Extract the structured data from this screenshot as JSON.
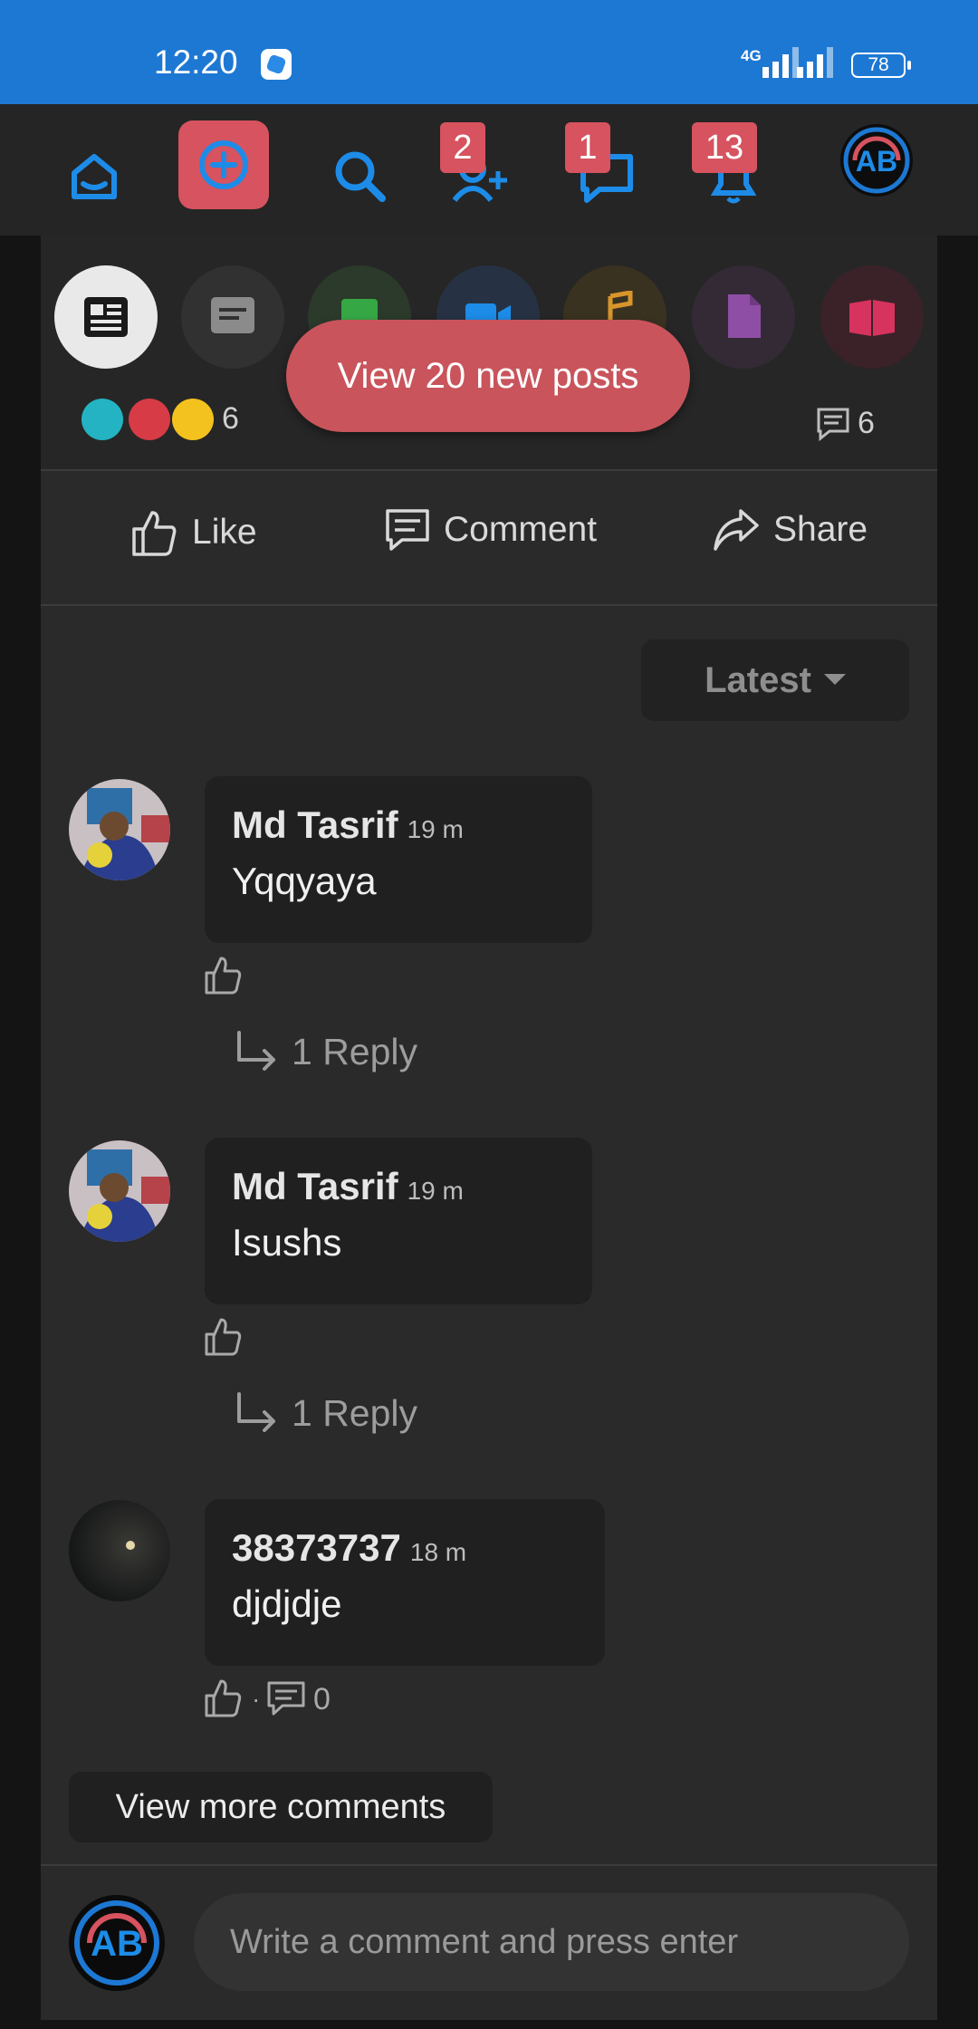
{
  "status": {
    "time": "12:20",
    "network": "4G",
    "battery": "78"
  },
  "nav": {
    "badge_friends": "2",
    "badge_messages": "1",
    "badge_notifications": "13"
  },
  "post": {
    "reaction_count": "6",
    "comment_count": "6",
    "actions": {
      "like": "Like",
      "comment": "Comment",
      "share": "Share"
    },
    "new_posts_label": "View 20 new posts"
  },
  "comments_section": {
    "sort_label": "Latest",
    "comments": [
      {
        "name": "Md Tasrif",
        "time": "19 m",
        "text": "Yqqyaya",
        "replies": "1 Reply"
      },
      {
        "name": "Md Tasrif",
        "time": "19 m",
        "text": "Isushs",
        "replies": "1 Reply"
      },
      {
        "name": "38373737",
        "time": "18 m",
        "text": "djdjdje",
        "reply_count": "0"
      }
    ],
    "view_more_label": "View more comments",
    "composer_placeholder": "Write a comment and press enter"
  },
  "colors": {
    "accent": "#1d8ce8",
    "badge": "#d6535f",
    "new_posts": "#c9545c",
    "background": "#2a2a2a"
  },
  "icons": [
    "home-icon",
    "create-post-icon",
    "search-icon",
    "friend-requests-icon",
    "messages-icon",
    "notifications-icon",
    "news-feed-icon",
    "text-post-icon",
    "photo-icon",
    "video-icon",
    "music-icon",
    "document-icon",
    "book-icon"
  ]
}
